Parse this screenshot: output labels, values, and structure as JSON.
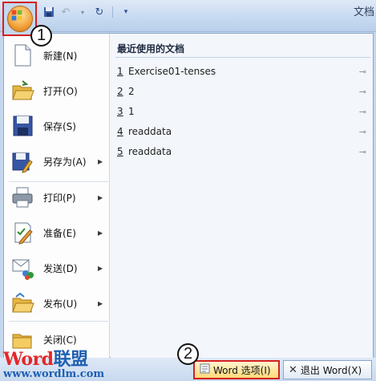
{
  "titlebar": {
    "title": "文档"
  },
  "badges": {
    "one": "1",
    "two": "2"
  },
  "menu_items": [
    {
      "label": "新建(N)",
      "icon": "new-document-icon"
    },
    {
      "label": "打开(O)",
      "icon": "open-folder-icon"
    },
    {
      "label": "保存(S)",
      "icon": "save-disk-icon"
    },
    {
      "label": "另存为(A)",
      "icon": "save-as-icon"
    },
    {
      "label": "打印(P)",
      "icon": "printer-icon"
    },
    {
      "label": "准备(E)",
      "icon": "prepare-icon"
    },
    {
      "label": "发送(D)",
      "icon": "send-icon"
    },
    {
      "label": "发布(U)",
      "icon": "publish-icon"
    },
    {
      "label": "关闭(C)",
      "icon": "close-folder-icon"
    }
  ],
  "recent": {
    "title": "最近使用的文档",
    "docs": [
      {
        "num": "1",
        "name": "Exercise01-tenses"
      },
      {
        "num": "2",
        "name": "2"
      },
      {
        "num": "3",
        "name": "1"
      },
      {
        "num": "4",
        "name": "readdata"
      },
      {
        "num": "5",
        "name": "readdata"
      }
    ]
  },
  "bottom": {
    "options_label": "Word 选项(I)",
    "exit_label": "退出 Word(X)"
  },
  "watermark": {
    "brand_a": "W",
    "brand_b": "ord",
    "brand_c": "联盟",
    "url": "www.wordlm.com"
  }
}
